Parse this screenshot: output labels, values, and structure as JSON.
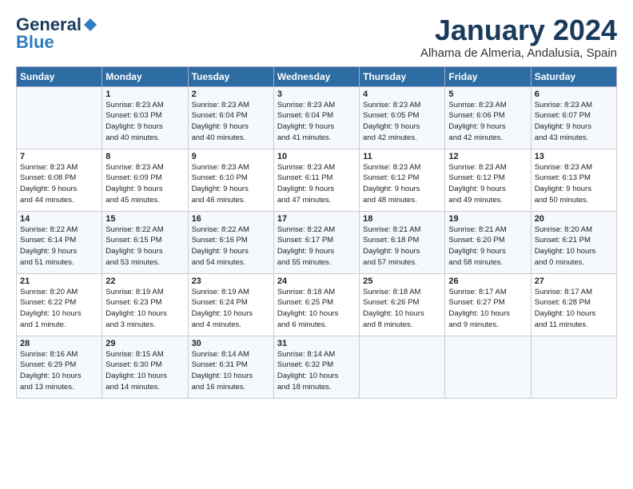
{
  "header": {
    "logo_general": "General",
    "logo_blue": "Blue",
    "month_title": "January 2024",
    "location": "Alhama de Almeria, Andalusia, Spain"
  },
  "days_of_week": [
    "Sunday",
    "Monday",
    "Tuesday",
    "Wednesday",
    "Thursday",
    "Friday",
    "Saturday"
  ],
  "weeks": [
    [
      {
        "num": "",
        "info": ""
      },
      {
        "num": "1",
        "info": "Sunrise: 8:23 AM\nSunset: 6:03 PM\nDaylight: 9 hours\nand 40 minutes."
      },
      {
        "num": "2",
        "info": "Sunrise: 8:23 AM\nSunset: 6:04 PM\nDaylight: 9 hours\nand 40 minutes."
      },
      {
        "num": "3",
        "info": "Sunrise: 8:23 AM\nSunset: 6:04 PM\nDaylight: 9 hours\nand 41 minutes."
      },
      {
        "num": "4",
        "info": "Sunrise: 8:23 AM\nSunset: 6:05 PM\nDaylight: 9 hours\nand 42 minutes."
      },
      {
        "num": "5",
        "info": "Sunrise: 8:23 AM\nSunset: 6:06 PM\nDaylight: 9 hours\nand 42 minutes."
      },
      {
        "num": "6",
        "info": "Sunrise: 8:23 AM\nSunset: 6:07 PM\nDaylight: 9 hours\nand 43 minutes."
      }
    ],
    [
      {
        "num": "7",
        "info": "Sunrise: 8:23 AM\nSunset: 6:08 PM\nDaylight: 9 hours\nand 44 minutes."
      },
      {
        "num": "8",
        "info": "Sunrise: 8:23 AM\nSunset: 6:09 PM\nDaylight: 9 hours\nand 45 minutes."
      },
      {
        "num": "9",
        "info": "Sunrise: 8:23 AM\nSunset: 6:10 PM\nDaylight: 9 hours\nand 46 minutes."
      },
      {
        "num": "10",
        "info": "Sunrise: 8:23 AM\nSunset: 6:11 PM\nDaylight: 9 hours\nand 47 minutes."
      },
      {
        "num": "11",
        "info": "Sunrise: 8:23 AM\nSunset: 6:12 PM\nDaylight: 9 hours\nand 48 minutes."
      },
      {
        "num": "12",
        "info": "Sunrise: 8:23 AM\nSunset: 6:12 PM\nDaylight: 9 hours\nand 49 minutes."
      },
      {
        "num": "13",
        "info": "Sunrise: 8:23 AM\nSunset: 6:13 PM\nDaylight: 9 hours\nand 50 minutes."
      }
    ],
    [
      {
        "num": "14",
        "info": "Sunrise: 8:22 AM\nSunset: 6:14 PM\nDaylight: 9 hours\nand 51 minutes."
      },
      {
        "num": "15",
        "info": "Sunrise: 8:22 AM\nSunset: 6:15 PM\nDaylight: 9 hours\nand 53 minutes."
      },
      {
        "num": "16",
        "info": "Sunrise: 8:22 AM\nSunset: 6:16 PM\nDaylight: 9 hours\nand 54 minutes."
      },
      {
        "num": "17",
        "info": "Sunrise: 8:22 AM\nSunset: 6:17 PM\nDaylight: 9 hours\nand 55 minutes."
      },
      {
        "num": "18",
        "info": "Sunrise: 8:21 AM\nSunset: 6:18 PM\nDaylight: 9 hours\nand 57 minutes."
      },
      {
        "num": "19",
        "info": "Sunrise: 8:21 AM\nSunset: 6:20 PM\nDaylight: 9 hours\nand 58 minutes."
      },
      {
        "num": "20",
        "info": "Sunrise: 8:20 AM\nSunset: 6:21 PM\nDaylight: 10 hours\nand 0 minutes."
      }
    ],
    [
      {
        "num": "21",
        "info": "Sunrise: 8:20 AM\nSunset: 6:22 PM\nDaylight: 10 hours\nand 1 minute."
      },
      {
        "num": "22",
        "info": "Sunrise: 8:19 AM\nSunset: 6:23 PM\nDaylight: 10 hours\nand 3 minutes."
      },
      {
        "num": "23",
        "info": "Sunrise: 8:19 AM\nSunset: 6:24 PM\nDaylight: 10 hours\nand 4 minutes."
      },
      {
        "num": "24",
        "info": "Sunrise: 8:18 AM\nSunset: 6:25 PM\nDaylight: 10 hours\nand 6 minutes."
      },
      {
        "num": "25",
        "info": "Sunrise: 8:18 AM\nSunset: 6:26 PM\nDaylight: 10 hours\nand 8 minutes."
      },
      {
        "num": "26",
        "info": "Sunrise: 8:17 AM\nSunset: 6:27 PM\nDaylight: 10 hours\nand 9 minutes."
      },
      {
        "num": "27",
        "info": "Sunrise: 8:17 AM\nSunset: 6:28 PM\nDaylight: 10 hours\nand 11 minutes."
      }
    ],
    [
      {
        "num": "28",
        "info": "Sunrise: 8:16 AM\nSunset: 6:29 PM\nDaylight: 10 hours\nand 13 minutes."
      },
      {
        "num": "29",
        "info": "Sunrise: 8:15 AM\nSunset: 6:30 PM\nDaylight: 10 hours\nand 14 minutes."
      },
      {
        "num": "30",
        "info": "Sunrise: 8:14 AM\nSunset: 6:31 PM\nDaylight: 10 hours\nand 16 minutes."
      },
      {
        "num": "31",
        "info": "Sunrise: 8:14 AM\nSunset: 6:32 PM\nDaylight: 10 hours\nand 18 minutes."
      },
      {
        "num": "",
        "info": ""
      },
      {
        "num": "",
        "info": ""
      },
      {
        "num": "",
        "info": ""
      }
    ]
  ]
}
